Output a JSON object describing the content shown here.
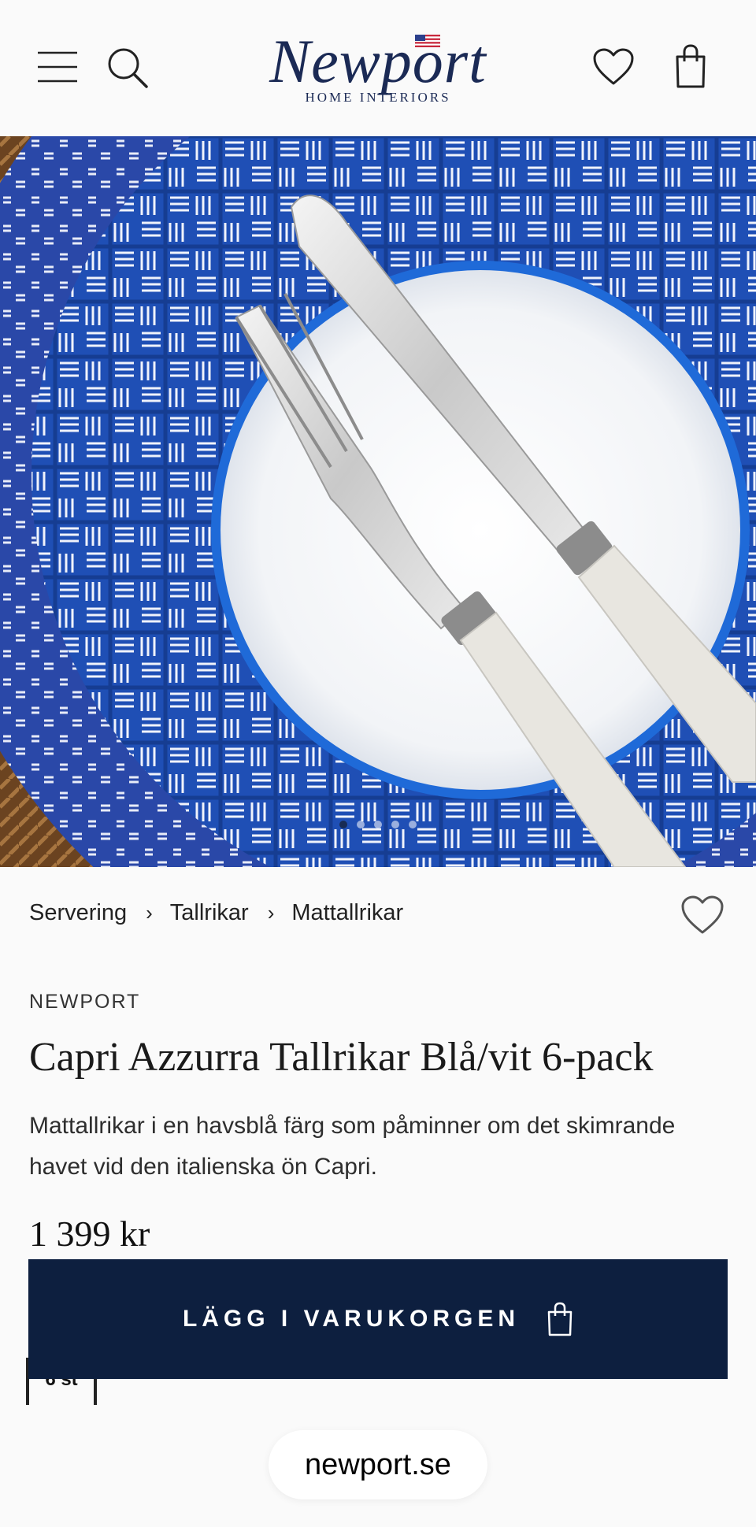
{
  "header": {
    "logo_word": "Newport",
    "logo_sub": "HOME INTERIORS",
    "icons": [
      "menu-icon",
      "search-icon",
      "heart-icon",
      "bag-icon"
    ]
  },
  "gallery": {
    "slide_count": 5,
    "active_slide": 1
  },
  "breadcrumb": {
    "items": [
      "Servering",
      "Tallrikar",
      "Mattallrikar"
    ],
    "separator": "›"
  },
  "product": {
    "brand": "NEWPORT",
    "title": "Capri Azzurra Tallrikar Blå/vit 6-pack",
    "description": "Mattallrikar i en havsblå färg som påminner om det skimrande havet vid den italienska ön Capri.",
    "price": "1 399 kr",
    "quantity": "6 st"
  },
  "cta": {
    "label": "LÄGG I VARUKORGEN"
  },
  "browser": {
    "url": "newport.se"
  },
  "colors": {
    "navy": "#0d1f3f",
    "logo": "#1b2a55",
    "plate_blue": "#1f4fb5"
  }
}
